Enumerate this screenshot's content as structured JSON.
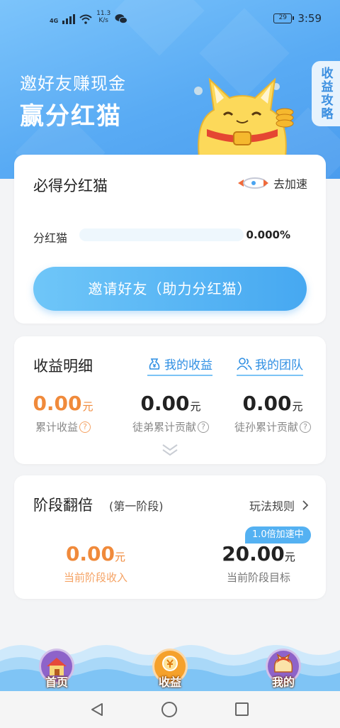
{
  "status_bar": {
    "network": "4G",
    "speed_value": "11.3",
    "speed_unit": "K/s",
    "battery": "29",
    "time": "3:59"
  },
  "hero": {
    "title_line1": "邀好友赚现金",
    "title_line2": "赢分红猫",
    "side_tab": "收益攻略"
  },
  "dividend_card": {
    "title": "必得分红猫",
    "speed_link": "去加速",
    "progress_label": "分红猫",
    "progress_value": "0.000%",
    "progress_fraction": 0,
    "invite_button": "邀请好友（助力分红猫）"
  },
  "earnings_card": {
    "title": "收益明细",
    "my_earnings_link": "我的收益",
    "my_team_link": "我的团队",
    "stats": [
      {
        "value": "0.00",
        "unit": "元",
        "label": "累计收益"
      },
      {
        "value": "0.00",
        "unit": "元",
        "label": "徒弟累计贡献"
      },
      {
        "value": "0.00",
        "unit": "元",
        "label": "徒孙累计贡献"
      }
    ],
    "help_mark": "?"
  },
  "stage_card": {
    "title": "阶段翻倍",
    "subtitle": "(第一阶段)",
    "rules_link": "玩法规则",
    "income_value": "0.00",
    "income_unit": "元",
    "income_label": "当前阶段收入",
    "target_value": "20.00",
    "target_unit": "元",
    "target_label": "当前阶段目标",
    "speed_badge": "1.0倍加速中"
  },
  "bottom_tabs": [
    {
      "label": "首页",
      "icon": "house-icon"
    },
    {
      "label": "收益",
      "icon": "coin-icon"
    },
    {
      "label": "我的",
      "icon": "cat-avatar-icon"
    }
  ],
  "colors": {
    "brand_blue": "#4aa4f0",
    "orange": "#f08a3b",
    "gold": "#f5b82e"
  }
}
